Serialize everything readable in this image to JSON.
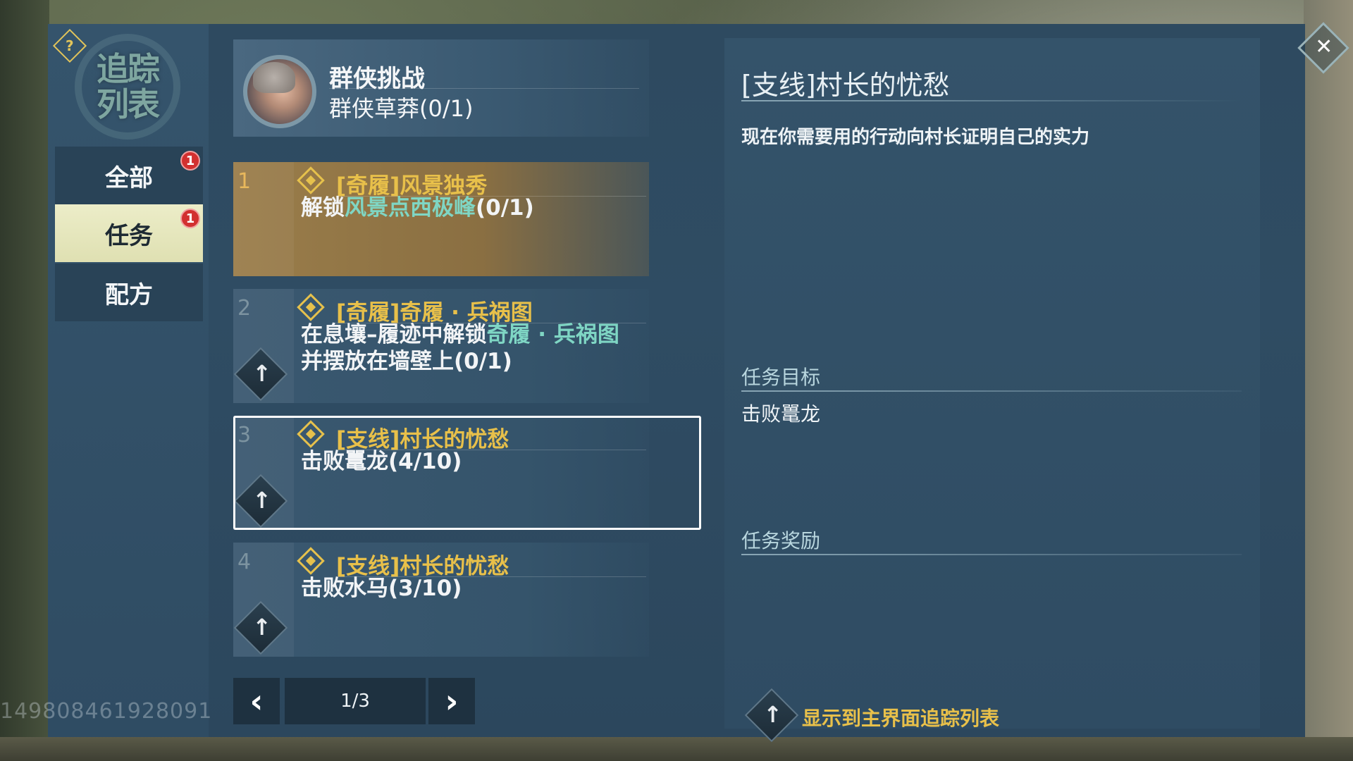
{
  "sidebar": {
    "emblem_text": "追踪列表",
    "tabs": [
      {
        "label": "全部",
        "badge": "1"
      },
      {
        "label": "任务",
        "badge": "1"
      },
      {
        "label": "配方",
        "badge": ""
      }
    ],
    "active_tab": "任务"
  },
  "challenge": {
    "title": "群侠挑战",
    "subtitle": "群侠草莽(0/1)"
  },
  "quests": [
    {
      "number": "1",
      "title": "[奇履]风景独秀",
      "desc_prefix": "解锁",
      "desc_highlight": "风景点西极峰",
      "desc_suffix": "(0/1)"
    },
    {
      "number": "2",
      "title": "[奇履]奇履 · 兵祸图",
      "desc_prefix": "在息壤–履迹中解锁",
      "desc_highlight": "奇履 · 兵祸图",
      "desc_suffix": "并摆放在墙壁上(0/1)"
    },
    {
      "number": "3",
      "title": "[支线]村长的忧愁",
      "desc_prefix": "击败鼍龙(4/10)",
      "desc_highlight": "",
      "desc_suffix": ""
    },
    {
      "number": "4",
      "title": "[支线]村长的忧愁",
      "desc_prefix": "击败水马(3/10)",
      "desc_highlight": "",
      "desc_suffix": ""
    }
  ],
  "pager": {
    "page": "1/3"
  },
  "detail": {
    "title": "[支线]村长的忧愁",
    "description": "现在你需要用的行动向村长证明自己的实力",
    "objective_label": "任务目标",
    "objective": "击败鼍龙",
    "reward_label": "任务奖励",
    "track_label": "显示到主界面追踪列表"
  },
  "uid": "149808461928091",
  "colors": {
    "accent": "#e8c04a",
    "highlight": "#7fd6c4",
    "badge": "#d23030",
    "active_tab": "#e4e5bc"
  }
}
